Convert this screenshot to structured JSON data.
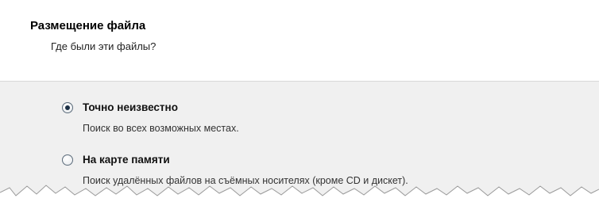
{
  "header": {
    "title": "Размещение файла",
    "subtitle": "Где были эти файлы?"
  },
  "options": [
    {
      "label": "Точно неизвестно",
      "description": "Поиск во всех возможных местах.",
      "selected": true
    },
    {
      "label": "На карте памяти",
      "description": "Поиск удалённых файлов на съёмных носителях (кроме CD и дискет).",
      "selected": false
    }
  ],
  "colors": {
    "header_bg": "#ffffff",
    "body_bg": "#f0f0f0",
    "radio_border": "#5b6b7a"
  }
}
